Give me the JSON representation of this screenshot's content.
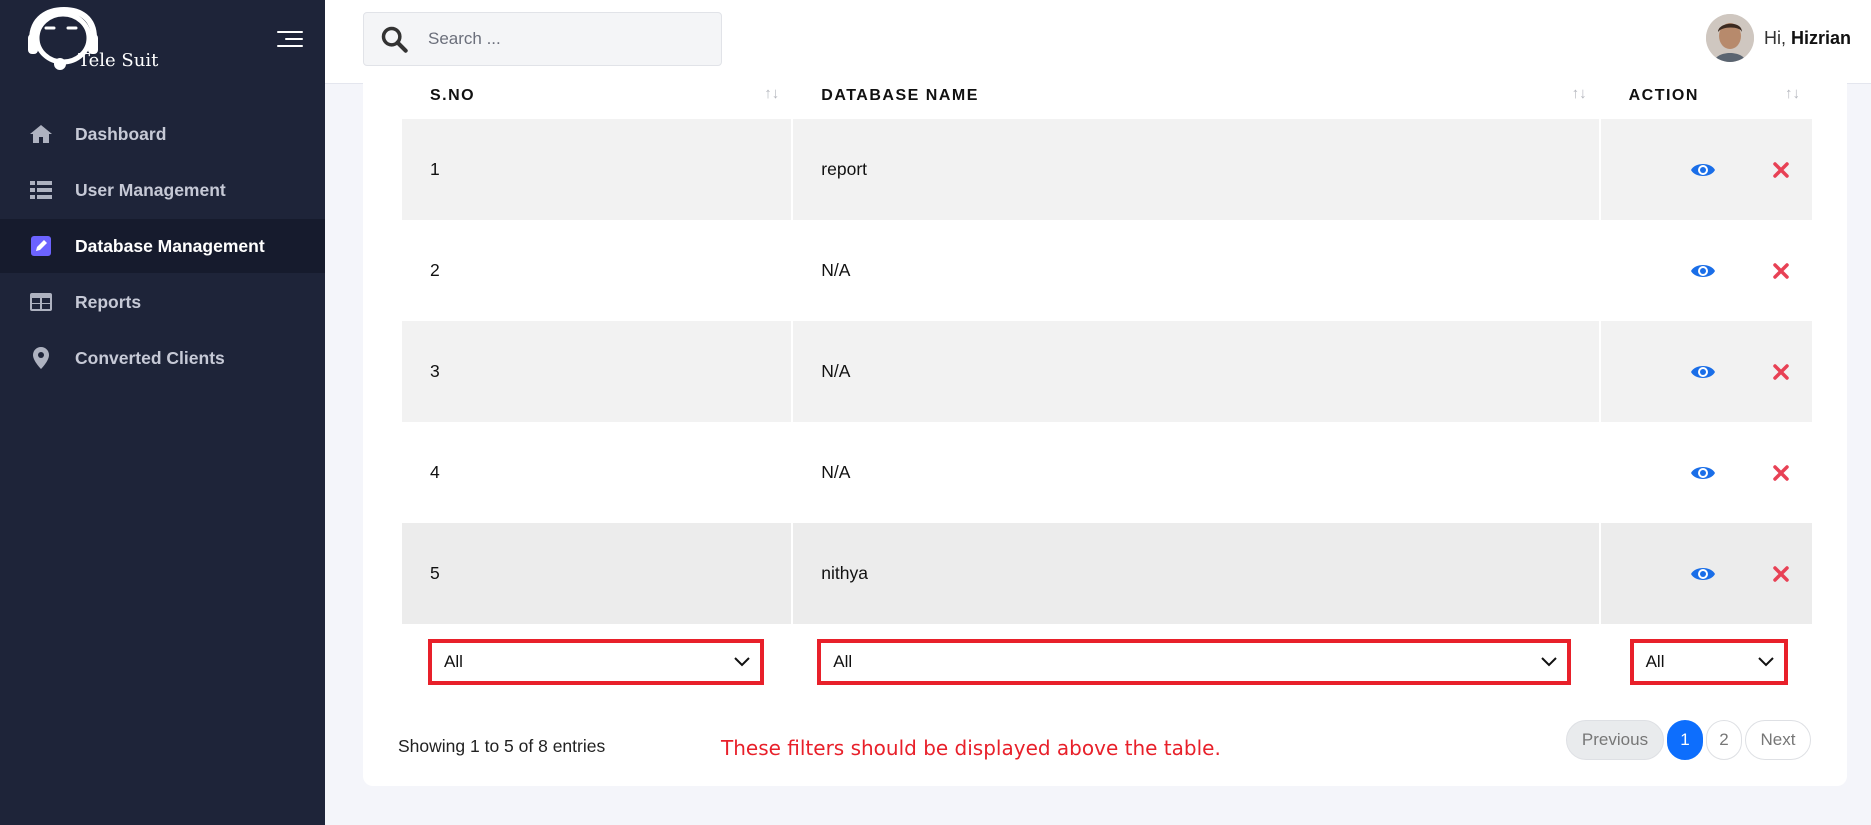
{
  "app": {
    "logo_text": "Tele Suit"
  },
  "sidebar": {
    "items": [
      {
        "label": "Dashboard",
        "icon": "home-icon",
        "active": false
      },
      {
        "label": "User Management",
        "icon": "list-icon",
        "active": false
      },
      {
        "label": "Database Management",
        "icon": "edit-icon",
        "active": true
      },
      {
        "label": "Reports",
        "icon": "table-icon",
        "active": false
      },
      {
        "label": "Converted Clients",
        "icon": "map-marker-icon",
        "active": false
      }
    ]
  },
  "header": {
    "search_placeholder": "Search ...",
    "greeting": "Hi,",
    "username": "Hizrian"
  },
  "table": {
    "columns": [
      "S.NO",
      "DATABASE NAME",
      "ACTION"
    ],
    "sort_glyph": "↑↓",
    "rows": [
      {
        "sno": "1",
        "name": "report"
      },
      {
        "sno": "2",
        "name": "N/A"
      },
      {
        "sno": "3",
        "name": "N/A"
      },
      {
        "sno": "4",
        "name": "N/A"
      },
      {
        "sno": "5",
        "name": "nithya"
      }
    ],
    "filters": [
      "All",
      "All",
      "All"
    ]
  },
  "footer": {
    "info": "Showing 1 to 5 of 8 entries",
    "annotation": "These filters should be displayed above the table.",
    "pager": {
      "previous": "Previous",
      "pages": [
        "1",
        "2"
      ],
      "current": "1",
      "next": "Next"
    }
  },
  "colors": {
    "sidebar_bg": "#1e2439",
    "accent": "#0d6efd",
    "delete": "#e84155",
    "annotation": "#e8202a",
    "active_icon": "#6c63ff"
  }
}
